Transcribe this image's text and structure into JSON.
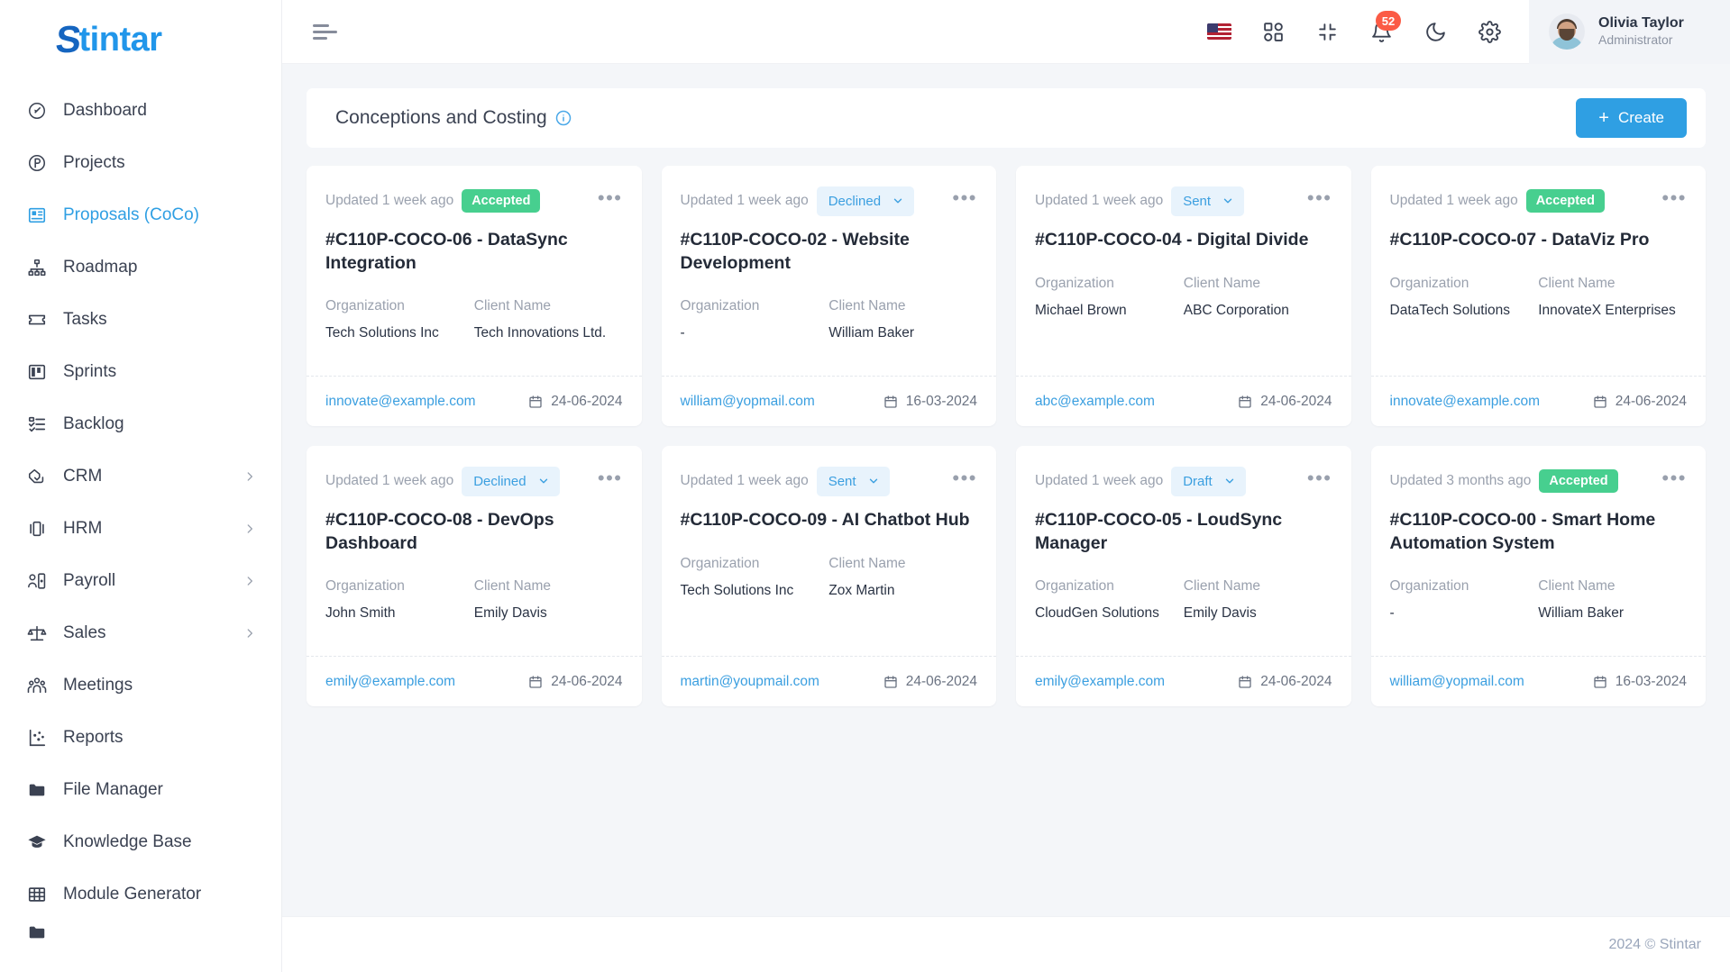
{
  "brand": {
    "name": "Stintar",
    "mark": "S",
    "rest": "tintar"
  },
  "sidebar": {
    "items": [
      {
        "label": "Dashboard",
        "icon": "gauge-icon",
        "active": false,
        "caret": false
      },
      {
        "label": "Projects",
        "icon": "circle-p-icon",
        "active": false,
        "caret": false
      },
      {
        "label": "Proposals (CoCo)",
        "icon": "proposal-icon",
        "active": true,
        "caret": false
      },
      {
        "label": "Roadmap",
        "icon": "sitemap-icon",
        "active": false,
        "caret": false
      },
      {
        "label": "Tasks",
        "icon": "ticket-icon",
        "active": false,
        "caret": false
      },
      {
        "label": "Sprints",
        "icon": "board-icon",
        "active": false,
        "caret": false
      },
      {
        "label": "Backlog",
        "icon": "checklist-icon",
        "active": false,
        "caret": false
      },
      {
        "label": "CRM",
        "icon": "handshake-icon",
        "active": false,
        "caret": true
      },
      {
        "label": "HRM",
        "icon": "cards-icon",
        "active": false,
        "caret": true
      },
      {
        "label": "Payroll",
        "icon": "person-badge-icon",
        "active": false,
        "caret": true
      },
      {
        "label": "Sales",
        "icon": "scales-icon",
        "active": false,
        "caret": true
      },
      {
        "label": "Meetings",
        "icon": "people-icon",
        "active": false,
        "caret": false
      },
      {
        "label": "Reports",
        "icon": "scatter-chart-icon",
        "active": false,
        "caret": false
      },
      {
        "label": "File Manager",
        "icon": "folder-icon",
        "active": false,
        "caret": false
      },
      {
        "label": "Knowledge Base",
        "icon": "graduation-cap-icon",
        "active": false,
        "caret": false
      },
      {
        "label": "Module Generator",
        "icon": "grid-table-icon",
        "active": false,
        "caret": false
      }
    ]
  },
  "topbar": {
    "menu_toggle": "hamburger-icon",
    "language_flag": "us-flag-icon",
    "apps_icon": "apps-grid-icon",
    "fullscreen_icon": "collapse-screen-icon",
    "notifications_icon": "bell-icon",
    "notifications_count": "52",
    "theme_icon": "moon-icon",
    "settings_icon": "gear-icon",
    "user": {
      "name": "Olivia Taylor",
      "role": "Administrator"
    }
  },
  "page": {
    "title": "Conceptions and Costing",
    "info_icon": "info-circle-icon",
    "create_label": "Create",
    "create_plus": "+"
  },
  "labels": {
    "organization": "Organization",
    "client_name": "Client Name"
  },
  "cards": [
    {
      "updated": "Updated 1 week ago",
      "status": "Accepted",
      "status_type": "badge",
      "title": "#C110P-COCO-06 - DataSync Integration",
      "organization": "Tech Solutions Inc",
      "client": "Tech Innovations Ltd.",
      "email": "innovate@example.com",
      "date": "24-06-2024"
    },
    {
      "updated": "Updated 1 week ago",
      "status": "Declined",
      "status_type": "select",
      "title": "#C110P-COCO-02 - Website Development",
      "organization": "-",
      "client": "William Baker",
      "email": "william@yopmail.com",
      "date": "16-03-2024"
    },
    {
      "updated": "Updated 1 week ago",
      "status": "Sent",
      "status_type": "select",
      "title": "#C110P-COCO-04 - Digital Divide",
      "organization": "Michael Brown",
      "client": "ABC Corporation",
      "email": "abc@example.com",
      "date": "24-06-2024"
    },
    {
      "updated": "Updated 1 week ago",
      "status": "Accepted",
      "status_type": "badge",
      "title": "#C110P-COCO-07 - DataViz Pro",
      "organization": "DataTech Solutions",
      "client": "InnovateX Enterprises",
      "email": "innovate@example.com",
      "date": "24-06-2024"
    },
    {
      "updated": "Updated 1 week ago",
      "status": "Declined",
      "status_type": "select",
      "title": "#C110P-COCO-08 - DevOps Dashboard",
      "organization": "John Smith",
      "client": "Emily Davis",
      "email": "emily@example.com",
      "date": "24-06-2024"
    },
    {
      "updated": "Updated 1 week ago",
      "status": "Sent",
      "status_type": "select",
      "title": "#C110P-COCO-09 - AI Chatbot Hub",
      "organization": "Tech Solutions Inc",
      "client": "Zox Martin",
      "email": "martin@youpmail.com",
      "date": "24-06-2024"
    },
    {
      "updated": "Updated 1 week ago",
      "status": "Draft",
      "status_type": "select",
      "title": "#C110P-COCO-05 - LoudSync Manager",
      "organization": "CloudGen Solutions",
      "client": "Emily Davis",
      "email": "emily@example.com",
      "date": "24-06-2024"
    },
    {
      "updated": "Updated 3 months ago",
      "status": "Accepted",
      "status_type": "badge",
      "title": "#C110P-COCO-00 - Smart Home Automation System",
      "organization": "-",
      "client": "William Baker",
      "email": "william@yopmail.com",
      "date": "16-03-2024"
    }
  ],
  "footer": {
    "copyright": "2024 © Stintar"
  },
  "colors": {
    "accent": "#2f9fe3",
    "accepted_green": "#47cf8f",
    "badge_red": "#fb5b45",
    "select_bg": "#e8f3fc",
    "page_bg": "#f4f6f9"
  }
}
